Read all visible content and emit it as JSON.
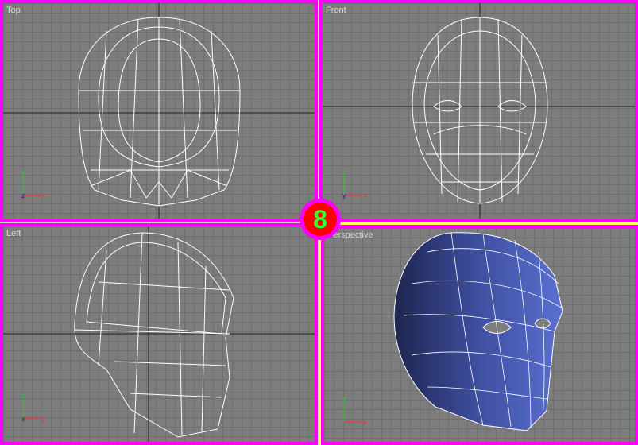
{
  "viewports": [
    {
      "label": "Top",
      "axes": {
        "up": "y",
        "right": "x",
        "center": "z"
      }
    },
    {
      "label": "Front",
      "axes": {
        "up": "z",
        "right": "x",
        "center": "y"
      }
    },
    {
      "label": "Left",
      "axes": {
        "up": "z",
        "right": "y",
        "center": "x"
      }
    },
    {
      "label": "Perspective",
      "axes": {
        "up": "z",
        "right": "x",
        "center": "y"
      }
    }
  ],
  "badge": {
    "text": "8",
    "icon": "hotkey-badge"
  },
  "colors": {
    "viewport_border": "#ff00ff",
    "active_border": "#ffff66",
    "wireframe": "#ffffff",
    "mesh": "#4a5cb0",
    "background": "#7d7d7d"
  }
}
